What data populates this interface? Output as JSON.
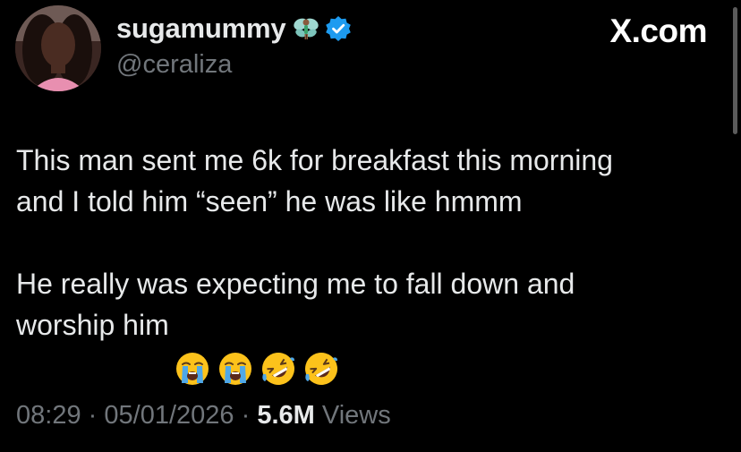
{
  "author": {
    "display_name": "sugamummy",
    "handle": "@ceraliza",
    "badge_icon": "fairy-emoji-icon",
    "verified_icon": "verified-badge-icon",
    "verified_color": "#1d9bf0"
  },
  "site_label": "X.com",
  "tweet": {
    "paragraph_1": "This man sent me 6k for breakfast this morning\nand I told him “seen” he was like hmmm",
    "paragraph_2": "He really was expecting me to fall down and\nworship him",
    "emojis": [
      "loudly-crying-face-icon",
      "loudly-crying-face-icon",
      "rolling-on-floor-laughing-icon",
      "rolling-on-floor-laughing-icon"
    ]
  },
  "meta": {
    "time": "08:29",
    "separator": "·",
    "date": "05/01/2026",
    "views_count": "5.6M",
    "views_label": "Views"
  },
  "colors": {
    "background": "#000000",
    "primary_text": "#e7e9ea",
    "secondary_text": "#71767b",
    "accent": "#1d9bf0"
  }
}
